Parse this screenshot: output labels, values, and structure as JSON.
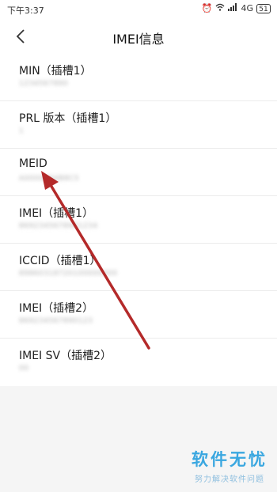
{
  "status_bar": {
    "time": "下午3:37",
    "network": "4G",
    "battery": "51",
    "icons": [
      "alarm-icon",
      "wifi-icon",
      "signal-icon",
      "battery-icon"
    ]
  },
  "header": {
    "title": "IMEI信息"
  },
  "items": [
    {
      "label": "MIN（插槽1）",
      "value": "1234567890"
    },
    {
      "label": "PRL 版本（插槽1）",
      "value": "1"
    },
    {
      "label": "MEID",
      "value": "A0000084B8C5"
    },
    {
      "label": "IMEI（插槽1）",
      "value": "8692345678901234"
    },
    {
      "label": "ICCID（插槽1）",
      "value": "89860318720100000000"
    },
    {
      "label": "IMEI（插槽2）",
      "value": "869234567890123"
    },
    {
      "label": "IMEI SV（插槽2）",
      "value": "00"
    }
  ],
  "annotation": {
    "color": "#b42a2a"
  },
  "watermark": {
    "main": "软件无忧",
    "sub": "努力解决软件问题",
    "color": "#3aa7e0"
  }
}
